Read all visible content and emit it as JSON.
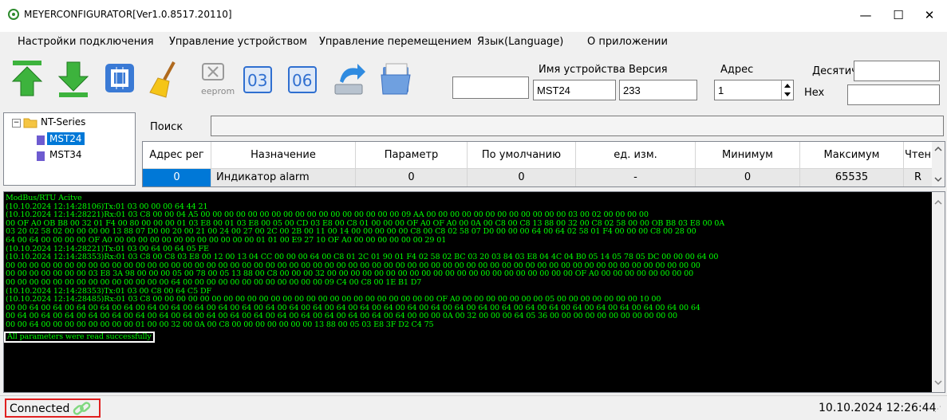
{
  "window": {
    "title": "MEYERCONFIGURATOR[Ver1.0.8517.20110]"
  },
  "menu": [
    "Настройки подключения",
    "Управление устройством",
    "Управление перемещением",
    "Язык(Language)",
    "О приложении"
  ],
  "toolbar": {
    "eeprom_label": "eeprom",
    "func03_label": "03",
    "func06_label": "06",
    "device_name_label": "Имя устройства",
    "version_label": "Версия",
    "address_label": "Адрес",
    "decimal_label": "Десятичн",
    "hex_label": "Hex",
    "device_name_value": "MST24",
    "version_value": "233",
    "address_value": "1",
    "decimal_value": "",
    "hex_value": "",
    "blank_value": ""
  },
  "tree": {
    "root": "NT-Series",
    "children": [
      "MST24",
      "MST34"
    ],
    "selected": "MST24"
  },
  "search": {
    "label": "Поиск",
    "value": ""
  },
  "table": {
    "columns": [
      "Адрес рег",
      "Назначение",
      "Параметр",
      "По умолчанию",
      "ед. изм.",
      "Минимум",
      "Максимум",
      "Чтен"
    ],
    "rows": [
      [
        "0",
        "Индикатор alarm",
        "0",
        "0",
        "-",
        "0",
        "65535",
        "R"
      ]
    ]
  },
  "console": {
    "lines": [
      "ModBus/RTU Acitve",
      "(10.10.2024 12:14:28106)Tx:01 03 00 00 00 64 44 21",
      "(10.10.2024 12:14:28221)Rx:01 03 C8 00 00 04 A5 00 00 00 00 00 00 00 00 00 00 00 00 00 00 00 00 00 09 AA 00 00 00 00 00 00 00 00 00 00 00 00 03 00 02 00 00 00 00",
      "00 OF A0 OB B8 00 32 01 F4 00 80 00 00 00 01 03 E8 00 01 03 E8 00 05 00 CD 03 E8 00 C8 01 00 00 00 OF A0 OF A0 00 0A 00 C8 00 C8 13 88 00 32 00 C8 02 58 00 00 OB B8 03 E8 00 0A",
      "03 20 02 58 02 00 00 00 00 13 88 07 D0 00 20 00 21 00 24 00 27 00 2C 00 2B 00 11 00 14 00 00 00 00 00 C8 00 C8 02 58 07 D0 00 00 00 64 00 64 02 58 01 F4 00 00 00 C8 00 28 00",
      "64 00 64 00 00 00 00 OF A0 00 00 00 00 00 00 00 00 00 00 00 00 01 01 00 E9 27 10 OF A0 00 00 00 00 00 00 29 01",
      "(10.10.2024 12:14:28221)Tx:01 03 00 64 00 64 05 FE",
      "(10.10.2024 12:14:28353)Rx:01 03 C8 00 C8 03 E8 00 12 00 13 04 CC 00 00 00 64 00 C8 01 2C 01 90 01 F4 02 58 02 BC 03 20 03 84 03 E8 04 4C 04 B0 05 14 05 78 05 DC 00 00 00 64 00",
      "00 00 00 00 00 00 00 00 00 00 00 00 00 00 00 00 00 00 00 00 00 00 00 00 00 00 00 00 00 00 00 00 00 00 00 00 00 00 00 00 00 00 00 00 00 00 00 00 00 00 00 00 00 00 00 00 00 00 00",
      "00 00 00 00 00 00 00 03 E8 3A 98 00 00 00 05 00 78 00 05 13 88 00 C8 00 00 00 32 00 00 00 00 00 00 00 00 00 00 00 00 00 00 00 00 00 00 00 00 00 OF A0 00 00 00 00 00 00 00 00",
      "00 00 00 00 00 00 00 00 00 00 00 00 00 00 64 00 00 00 00 00 00 00 00 00 00 00 00 09 C4 00 C8 00 1E B1 D7",
      "(10.10.2024 12:14:28353)Tx:01 03 00 C8 00 64 C5 DF",
      "(10.10.2024 12:14:28485)Rx:01 03 C8 00 00 00 00 00 00 00 00 00 00 00 00 00 00 00 00 00 00 00 00 00 00 00 00 OF A0 00 00 00 00 00 00 00 05 00 00 00 00 00 00 00 10 00",
      "00 00 64 00 64 00 64 00 64 00 64 00 64 00 64 00 64 00 64 00 64 00 64 00 64 00 64 00 64 00 64 00 64 00 64 00 64 00 64 00 64 00 64 00 64 00 64 00 64 00 64 00 64 00 64 00 64 00 64",
      "00 64 00 64 00 64 00 64 00 64 00 64 00 64 00 64 00 64 00 64 00 64 00 64 00 64 00 64 00 64 00 64 00 64 00 00 00 0A 00 32 00 00 00 64 05 36 00 00 00 00 00 00 00 00 00 00 00",
      "00 00 64 00 00 00 00 00 00 00 00 01 00 00 32 00 0A 00 C8 00 00 00 00 00 00 00 13 88 00 05 03 E8 3F D2 C4 75",
      "All parameters were read successfully"
    ],
    "highlight_index": 16
  },
  "status": {
    "connection": "Connected",
    "datetime": "10.10.2024 12:26:44"
  },
  "colors": {
    "console_bg": "#000000",
    "console_text": "#00ff00",
    "selection": "#0078d7",
    "status_highlight_border": "#e02020"
  }
}
